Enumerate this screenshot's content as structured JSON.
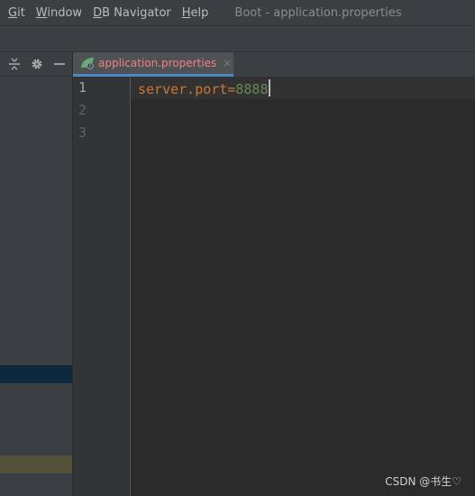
{
  "menu": {
    "items": [
      {
        "mnemonic": "G",
        "rest": "it"
      },
      {
        "mnemonic": "W",
        "rest": "indow"
      },
      {
        "mnemonic": "D",
        "rest": "B Navigator"
      },
      {
        "mnemonic": "H",
        "rest": "elp"
      }
    ],
    "window_title": "Boot - application.properties"
  },
  "panel": {
    "icons": [
      "collapse-icon",
      "gear-icon",
      "minimize-icon"
    ]
  },
  "tabs": [
    {
      "label": "application.properties",
      "close": "×",
      "icon": "spring-leaf-icon"
    }
  ],
  "editor": {
    "line_numbers": [
      "1",
      "2",
      "3"
    ],
    "code": {
      "key": "server.port",
      "eq": "=",
      "value": "8888"
    }
  },
  "colors": {
    "accent": "#4a88c7",
    "tab_text": "#f08080",
    "key": "#cc7832",
    "value": "#6a8759"
  },
  "watermark": "CSDN @书生♡"
}
